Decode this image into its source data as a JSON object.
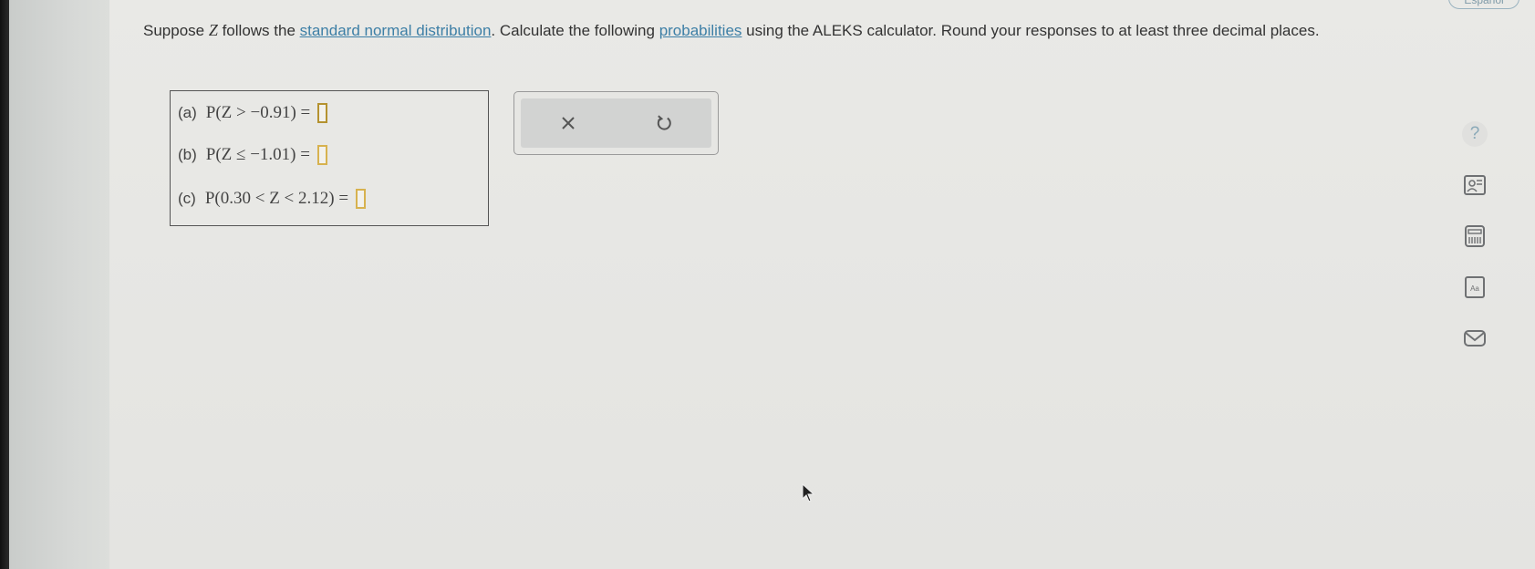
{
  "header": {
    "language_button": "Español"
  },
  "problem": {
    "prompt_part1": "Suppose ",
    "variable": "Z",
    "prompt_part2": " follows the ",
    "link1": "standard normal distribution",
    "prompt_part3": ". Calculate the following ",
    "link2": "probabilities",
    "prompt_part4": " using the ALEKS calculator. Round your responses to at least three decimal places."
  },
  "questions": [
    {
      "label": "(a)",
      "expression": "P(Z > −0.91) =",
      "answer": ""
    },
    {
      "label": "(b)",
      "expression": "P(Z ≤ −1.01) =",
      "answer": ""
    },
    {
      "label": "(c)",
      "expression": "P(0.30 < Z < 2.12) =",
      "answer": ""
    }
  ],
  "actions": {
    "clear_symbol": "×",
    "undo_symbol": "↺"
  },
  "sidebar": {
    "help_symbol": "?",
    "icons": [
      "help-icon",
      "textbook-icon",
      "calculator-icon",
      "formula-icon",
      "mail-icon"
    ]
  },
  "colors": {
    "link": "#3d7fa6",
    "answer_border": "#d7b24f",
    "help": "#8aa9b8"
  }
}
